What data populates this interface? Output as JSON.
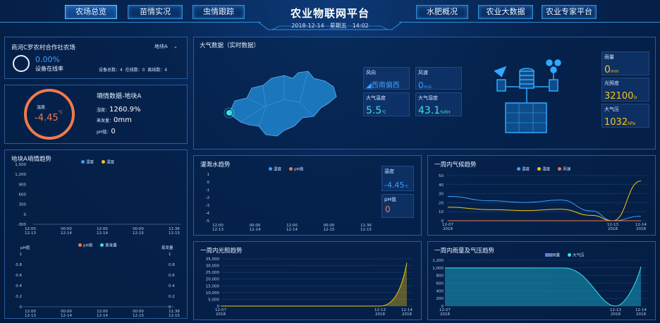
{
  "header": {
    "title": "农业物联网平台",
    "date": "2018-12-14",
    "weekday": "星期五",
    "time": "14:02",
    "nav_left": [
      "农场总览",
      "苗情实况",
      "虫情跟踪"
    ],
    "nav_right": [
      "水肥概况",
      "农业大数据",
      "农业专家平台"
    ],
    "active": "农场总览"
  },
  "farm": {
    "name": "商河C罗农村合作社农场",
    "plot_select": "地块A",
    "online_rate": "0.00%",
    "online_label": "设备在线率",
    "stats": "设备总数：4  在线数：0  离线数：4"
  },
  "soil": {
    "gauge_label": "温度",
    "gauge_value": "-4.45",
    "gauge_unit": "℃",
    "title": "墒情数据-地块A",
    "humidity_label": "湿度：",
    "humidity_value": "1260.9%",
    "evap_label": "蒸发量：",
    "evap_value": "0mm",
    "ph_label": "pH值：",
    "ph_value": "0"
  },
  "soil_trend": {
    "title": "地块A墒情趋势",
    "legend": [
      "湿度",
      "温度"
    ],
    "y_ticks": [
      "1,500",
      "1,200",
      "900",
      "600",
      "300",
      "0",
      "-300"
    ],
    "x_ticks": [
      [
        "12:00",
        "12-13"
      ],
      [
        "00:00",
        "12-14"
      ],
      [
        "12:00",
        "12-14"
      ],
      [
        "00:00",
        "12-15"
      ],
      [
        "11:36",
        "12-15"
      ]
    ],
    "legend2": [
      "pH值",
      "蒸发量"
    ],
    "y2_left_title": "pH值",
    "y2_right_title": "蒸发量",
    "y2_ticks": [
      "1",
      "0.8",
      "0.6",
      "0.4",
      "0.2",
      "0"
    ],
    "colors": {
      "humidity": "#3aa0ff",
      "temperature": "#f5c518",
      "ph": "#f07a4a",
      "evap": "#3de0e0"
    }
  },
  "weather": {
    "title": "大气数据（实时数据）",
    "wind_dir_label": "风向",
    "wind_dir_value": "西南偏西",
    "wind_speed_label": "风速",
    "wind_speed_value": "0",
    "wind_speed_unit": "m/s",
    "air_temp_label": "大气温度",
    "air_temp_value": "5.5",
    "air_temp_unit": "℃",
    "air_hum_label": "大气湿度",
    "air_hum_value": "43.1",
    "air_hum_unit": "%RH",
    "rain_label": "雨量",
    "rain_value": "0",
    "rain_unit": "mm",
    "light_label": "光照度",
    "light_value": "32100",
    "light_unit": "lx",
    "pressure_label": "大气压",
    "pressure_value": "1032",
    "pressure_unit": "hPa"
  },
  "irrigation": {
    "title": "灌溉水趋势",
    "legend": [
      "温度",
      "pH值"
    ],
    "y_ticks": [
      "1",
      "0",
      "-1",
      "-2",
      "-3",
      "-4",
      "-5"
    ],
    "x_ticks": [
      [
        "12:00",
        "12-13"
      ],
      [
        "00:00",
        "12-14"
      ],
      [
        "12:00",
        "12-14"
      ],
      [
        "00:00",
        "12-15"
      ],
      [
        "11:36",
        "12-15"
      ]
    ],
    "temp_label": "温度",
    "temp_value": "-4.45",
    "temp_unit": "℃",
    "ph_label": "pH值",
    "ph_value": "0"
  },
  "climate": {
    "title": "一周内气候趋势",
    "legend": [
      "湿度",
      "温度",
      "风速"
    ],
    "y_ticks": [
      "50",
      "40",
      "30",
      "20",
      "10",
      "0"
    ],
    "x_ticks": [
      [
        "12-07",
        "2018"
      ],
      [
        "12-13",
        "2018"
      ],
      [
        "12-14",
        "2018"
      ]
    ]
  },
  "light": {
    "title": "一周内光照趋势",
    "y_ticks": [
      "35,000",
      "30,000",
      "25,000",
      "20,000",
      "15,000",
      "10,000",
      "5,000",
      "0"
    ],
    "x_ticks": [
      [
        "12-07",
        "2018"
      ],
      [
        "12-13",
        "2018"
      ],
      [
        "12-14",
        "2018"
      ]
    ]
  },
  "rain_pressure": {
    "title": "一周内雨量及气压趋势",
    "legend": [
      "雨量",
      "大气压"
    ],
    "y_ticks": [
      "1,200",
      "1,000",
      "800",
      "600",
      "400",
      "200",
      "0"
    ],
    "x_ticks": [
      [
        "12-07",
        "2018"
      ],
      [
        "12-13",
        "2018"
      ],
      [
        "12-14",
        "2018"
      ]
    ]
  },
  "chart_data": [
    {
      "type": "line",
      "title": "一周内气候趋势",
      "x": [
        "12-07",
        "12-13",
        "12-14"
      ],
      "series": [
        {
          "name": "湿度",
          "values": [
            27,
            0,
            5
          ]
        },
        {
          "name": "温度",
          "values": [
            15,
            0,
            44
          ]
        },
        {
          "name": "风速",
          "values": [
            0,
            0,
            0
          ]
        }
      ],
      "ylim": [
        0,
        50
      ]
    },
    {
      "type": "area",
      "title": "一周内光照趋势",
      "x": [
        "12-07",
        "12-13",
        "12-14"
      ],
      "series": [
        {
          "name": "光照度",
          "values": [
            0,
            0,
            32100
          ]
        }
      ],
      "ylim": [
        0,
        35000
      ]
    },
    {
      "type": "area",
      "title": "一周内雨量及气压趋势",
      "x": [
        "12-07",
        "12-13",
        "12-14"
      ],
      "series": [
        {
          "name": "雨量",
          "values": [
            0,
            0,
            0
          ]
        },
        {
          "name": "大气压",
          "values": [
            1000,
            0,
            1032
          ]
        }
      ],
      "ylim": [
        0,
        1200
      ]
    }
  ]
}
